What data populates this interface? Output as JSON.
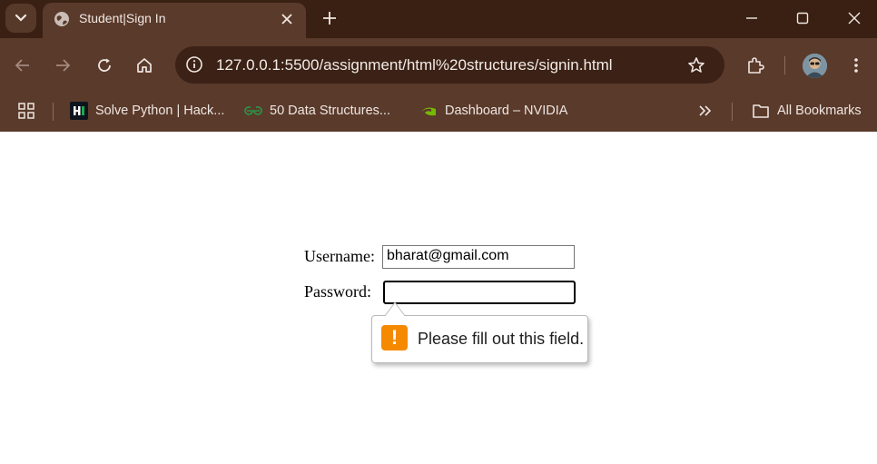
{
  "browser": {
    "tab": {
      "title": "Student|Sign In",
      "favicon": "globe-icon"
    },
    "address_bar": {
      "url": "127.0.0.1:5500/assignment/html%20structures/signin.html"
    },
    "bookmarks": [
      {
        "label": "Solve Python | Hack...",
        "icon": "hackerrank-icon"
      },
      {
        "label": "50 Data Structures...",
        "icon": "geeksforgeeks-icon"
      },
      {
        "label": "Dashboard – NVIDIA",
        "icon": "nvidia-icon"
      }
    ],
    "all_bookmarks_label": "All Bookmarks",
    "colors": {
      "titlebar": "#3a2012",
      "toolbar": "#5a3a2b",
      "omnibox": "#3b2116"
    }
  },
  "form": {
    "username_label": "Username:",
    "username_value": "bharat@gmail.com",
    "password_label": "Password:",
    "password_value": ""
  },
  "validation": {
    "message": "Please fill out this field.",
    "icon": "warning-icon",
    "color": "#f58a00"
  }
}
